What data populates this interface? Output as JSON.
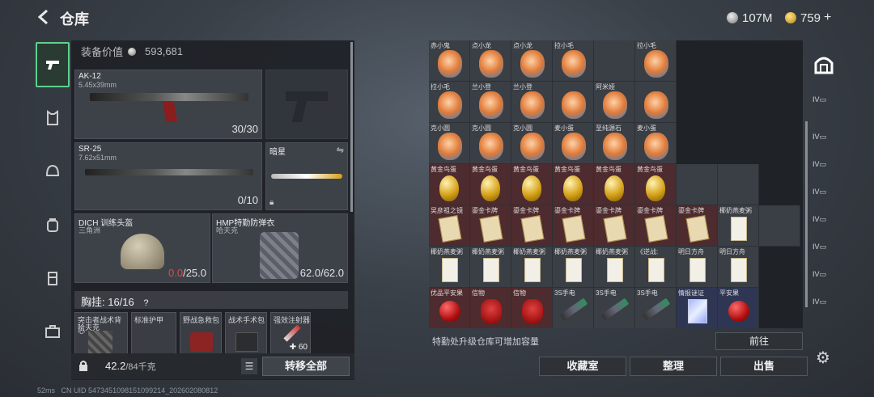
{
  "header": {
    "title": "仓库",
    "silver": "107M",
    "gold": "759"
  },
  "loadout": {
    "equip_value_label": "装备价值",
    "equip_value": "593,681",
    "primary": {
      "name": "AK-12",
      "caliber": "5.45x39mm",
      "ammo": "30/30"
    },
    "secondary": {
      "name": "SR-25",
      "caliber": "7.62x51mm",
      "ammo": "0/10"
    },
    "melee": {
      "name": "暗星"
    },
    "helmet": {
      "name": "DICH 训练头盔",
      "sub": "三角洲",
      "dur_cur": "0.0",
      "dur_max": "/25.0"
    },
    "armor": {
      "name": "HMP特勤防弹衣",
      "sub": "哈夫克",
      "dur": "62.0/62.0"
    },
    "chest_label": "胸挂:  16/16",
    "small_slots": [
      {
        "label": "突击者战术背心",
        "sub": "哈夫克"
      },
      {
        "label": "标准护甲"
      },
      {
        "label": "野战急救包"
      },
      {
        "label": "战术手术包"
      },
      {
        "label": "强效注射器",
        "count": "60"
      }
    ],
    "weight": "42.2",
    "weight_max": "/84千克",
    "transfer_all": "转移全部"
  },
  "stash": {
    "rows": [
      [
        {
          "l": "赤小鬼",
          "t": "figure",
          "c": ""
        },
        {
          "l": "点小龙",
          "t": "figure",
          "c": ""
        },
        {
          "l": "点小龙",
          "t": "figure",
          "c": ""
        },
        {
          "l": "拉小毛",
          "t": "figure",
          "c": ""
        },
        {
          "l": "",
          "t": "",
          "c": ""
        },
        {
          "l": "拉小毛",
          "t": "figure",
          "c": ""
        }
      ],
      [
        {
          "l": "拉小毛",
          "t": "figure",
          "c": ""
        },
        {
          "l": "兰小登",
          "t": "figure",
          "c": ""
        },
        {
          "l": "兰小登",
          "t": "figure",
          "c": ""
        },
        {
          "l": "",
          "t": "figure",
          "c": ""
        },
        {
          "l": "阿米娅",
          "t": "figure",
          "c": ""
        },
        {
          "l": "",
          "t": "figure",
          "c": ""
        }
      ],
      [
        {
          "l": "克小圆",
          "t": "figure",
          "c": ""
        },
        {
          "l": "克小圆",
          "t": "figure",
          "c": ""
        },
        {
          "l": "克小圆",
          "t": "figure",
          "c": ""
        },
        {
          "l": "麦小蛋",
          "t": "figure",
          "c": ""
        },
        {
          "l": "至纯源石",
          "t": "figure",
          "c": ""
        },
        {
          "l": "麦小蛋",
          "t": "figure",
          "c": ""
        }
      ],
      [
        {
          "l": "黄金鸟蛋",
          "t": "egg",
          "c": "red"
        },
        {
          "l": "黄金鸟蛋",
          "t": "egg",
          "c": "red"
        },
        {
          "l": "黄金鸟蛋",
          "t": "egg",
          "c": "red"
        },
        {
          "l": "黄金鸟蛋",
          "t": "egg",
          "c": "red"
        },
        {
          "l": "黄金鸟蛋",
          "t": "egg",
          "c": "red"
        },
        {
          "l": "黄金鸟蛋",
          "t": "egg",
          "c": "red"
        },
        {
          "l": "",
          "t": "",
          "c": ""
        },
        {
          "l": "",
          "t": "",
          "c": ""
        }
      ],
      [
        {
          "l": "吴彦祖之镜",
          "t": "card",
          "c": "red"
        },
        {
          "l": "鎏金卡牌",
          "t": "card",
          "c": "red"
        },
        {
          "l": "鎏金卡牌",
          "t": "card",
          "c": "red"
        },
        {
          "l": "鎏金卡牌",
          "t": "card",
          "c": "red"
        },
        {
          "l": "鎏金卡牌",
          "t": "card",
          "c": "red"
        },
        {
          "l": "鎏金卡牌",
          "t": "card",
          "c": "red"
        },
        {
          "l": "鎏金卡牌",
          "t": "card",
          "c": "red"
        },
        {
          "l": "椰奶燕麦粥",
          "t": "pack",
          "c": ""
        },
        {
          "l": "",
          "t": "",
          "c": ""
        }
      ],
      [
        {
          "l": "椰奶燕麦粥",
          "t": "pack",
          "c": ""
        },
        {
          "l": "椰奶燕麦粥",
          "t": "pack",
          "c": ""
        },
        {
          "l": "椰奶燕麦粥",
          "t": "pack",
          "c": ""
        },
        {
          "l": "椰奶燕麦粥",
          "t": "pack",
          "c": ""
        },
        {
          "l": "椰奶燕麦粥",
          "t": "pack",
          "c": ""
        },
        {
          "l": "《逆战:",
          "t": "pack",
          "c": ""
        },
        {
          "l": "明日方舟",
          "t": "pack",
          "c": ""
        },
        {
          "l": "明日方舟",
          "t": "pack",
          "c": ""
        }
      ],
      [
        {
          "l": "优品平安果",
          "t": "apple",
          "c": "red"
        },
        {
          "l": "信物",
          "t": "mask",
          "c": "red"
        },
        {
          "l": "信物",
          "t": "mask",
          "c": "red"
        },
        {
          "l": "3S手电",
          "t": "torch",
          "c": ""
        },
        {
          "l": "3S手电",
          "t": "torch",
          "c": ""
        },
        {
          "l": "3S手电",
          "t": "torch",
          "c": ""
        },
        {
          "l": "情报谜证",
          "t": "info",
          "c": "blue"
        },
        {
          "l": "平安果",
          "t": "apple",
          "c": "blue"
        }
      ]
    ],
    "upgrade_hint": "特勤处升级仓库可增加容量",
    "goto": "前往",
    "collection": "收藏室",
    "organize": "整理",
    "sell": "出售"
  },
  "status": {
    "ping": "52ms",
    "uid": "CN UID 5473451098151099214_202602080812"
  }
}
